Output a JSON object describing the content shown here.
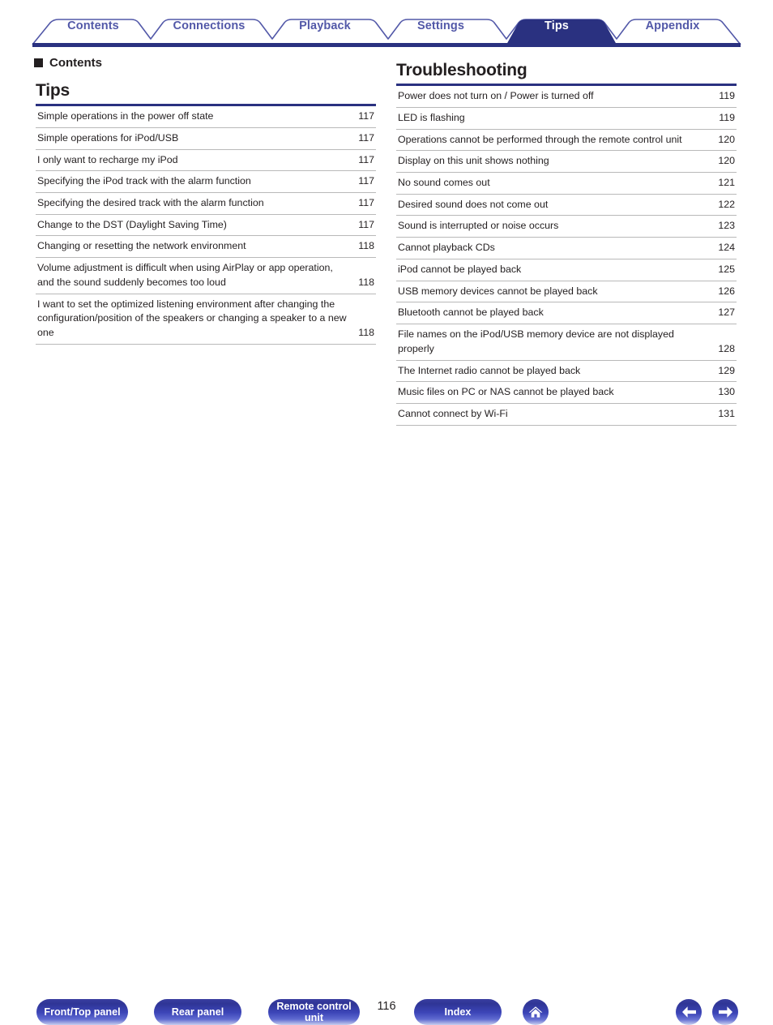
{
  "tabs": [
    {
      "label": "Contents",
      "active": false
    },
    {
      "label": "Connections",
      "active": false
    },
    {
      "label": "Playback",
      "active": false
    },
    {
      "label": "Settings",
      "active": false
    },
    {
      "label": "Tips",
      "active": true
    },
    {
      "label": "Appendix",
      "active": false
    }
  ],
  "section_mark": {
    "bullet": "square-bullet-icon",
    "label": "Contents"
  },
  "left_column": {
    "title": "Tips",
    "rows": [
      {
        "text": "Simple operations in the power off state",
        "page": "117"
      },
      {
        "text": "Simple operations for iPod/USB",
        "page": "117"
      },
      {
        "text": "I only want to recharge my iPod",
        "page": "117"
      },
      {
        "text": "Specifying the iPod track with the alarm function",
        "page": "117"
      },
      {
        "text": "Specifying the desired track with the alarm function",
        "page": "117"
      },
      {
        "text": "Change to the DST (Daylight Saving Time)",
        "page": "117"
      },
      {
        "text": "Changing or resetting the network environment",
        "page": "118"
      },
      {
        "text": "Volume adjustment is difficult when using AirPlay or app operation, and the sound suddenly becomes too loud",
        "page": "118"
      },
      {
        "text": "I want to set the optimized listening environment after changing the configuration/position of the speakers or changing a speaker to a new one",
        "page": "118"
      }
    ]
  },
  "right_column": {
    "title": "Troubleshooting",
    "rows": [
      {
        "text": "Power does not turn on / Power is turned off",
        "page": "119"
      },
      {
        "text": "LED is flashing",
        "page": "119"
      },
      {
        "text": "Operations cannot be performed through the remote control unit",
        "page": "120"
      },
      {
        "text": "Display on this unit shows nothing",
        "page": "120"
      },
      {
        "text": "No sound comes out",
        "page": "121"
      },
      {
        "text": "Desired sound does not come out",
        "page": "122"
      },
      {
        "text": "Sound is interrupted or noise occurs",
        "page": "123"
      },
      {
        "text": "Cannot playback CDs",
        "page": "124"
      },
      {
        "text": "iPod cannot be played back",
        "page": "125"
      },
      {
        "text": "USB memory devices cannot be played back",
        "page": "126"
      },
      {
        "text": "Bluetooth cannot be played back",
        "page": "127"
      },
      {
        "text": "File names on the iPod/USB memory device are not displayed properly",
        "page": "128"
      },
      {
        "text": "The Internet radio cannot be played back",
        "page": "129"
      },
      {
        "text": "Music files on PC or NAS cannot be played back",
        "page": "130"
      },
      {
        "text": "Cannot connect by Wi-Fi",
        "page": "131"
      }
    ]
  },
  "footer": {
    "front_top_panel": "Front/Top panel",
    "rear_panel": "Rear panel",
    "remote_control_unit": "Remote control unit",
    "index": "Index",
    "page_number": "116",
    "home_icon": "home-icon",
    "prev_icon": "arrow-left-icon",
    "next_icon": "arrow-right-icon"
  },
  "colors": {
    "tab_active_fill": "#2a3180",
    "tab_inactive_text": "#5258a8",
    "tab_outline": "#5258a8",
    "rule": "#2a3180",
    "row_separator": "#b9b9b9",
    "text": "#231f20"
  }
}
